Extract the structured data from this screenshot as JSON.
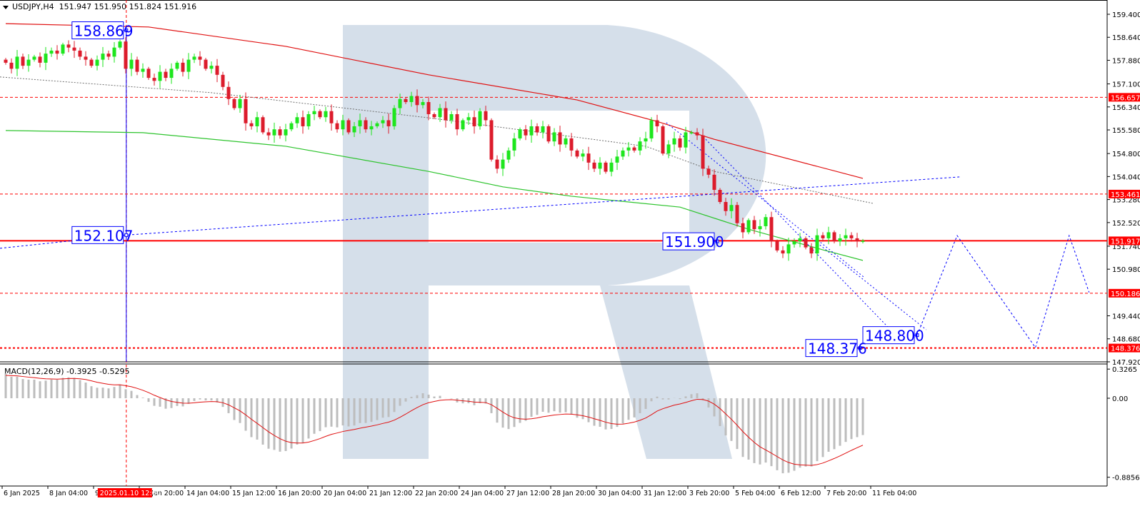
{
  "header": {
    "symbol": "USDJPY,H4",
    "ohlc": "151.947 151.950 151.824 151.916"
  },
  "macd": {
    "label": "MACD(12,26,9) -0.3925 -0.5295",
    "ticks": [
      "0.3265",
      "0.00",
      "-0.8856"
    ],
    "tick_values": [
      0.3265,
      0,
      -0.8856
    ]
  },
  "colors": {
    "up": "#1ee61e",
    "down": "#dc1c2c",
    "level": "#ff0000",
    "blue": "#0000ff",
    "ma_red": "#e01010",
    "ma_green": "#2ec42e",
    "gray": "#707070",
    "watermark": "#d5dfea",
    "hist": "#bdbdbd"
  },
  "chart_data": {
    "type": "candlestick",
    "ylim": [
      147.92,
      159.4
    ],
    "y_ticks": [
      "159.400",
      "158.640",
      "157.880",
      "157.100",
      "156.340",
      "155.580",
      "154.800",
      "154.040",
      "153.280",
      "152.520",
      "151.740",
      "150.980",
      "149.440",
      "148.680",
      "147.920"
    ],
    "x_ticks": [
      "6 Jan 2025",
      "8 Jan 04:00",
      "9 Jan 12:00",
      "10 Jan 20:00",
      "14 Jan 04:00",
      "15 Jan 12:00",
      "16 Jan 20:00",
      "20 Jan 04:00",
      "21 Jan 12:00",
      "22 Jan 20:00",
      "24 Jan 04:00",
      "27 Jan 12:00",
      "28 Jan 20:00",
      "30 Jan 04:00",
      "31 Jan 12:00",
      "3 Feb 20:00",
      "5 Feb 04:00",
      "6 Feb 12:00",
      "7 Feb 20:00",
      "11 Feb 04:00"
    ],
    "crosshair_time": "2025.01.10 12:00",
    "closes": [
      157.8,
      157.6,
      158.0,
      157.7,
      157.9,
      158.0,
      157.8,
      158.1,
      158.2,
      158.1,
      158.4,
      158.3,
      158.2,
      158.0,
      157.9,
      157.7,
      157.9,
      158.1,
      158.0,
      158.3,
      158.5,
      157.6,
      157.9,
      157.5,
      157.6,
      157.3,
      157.2,
      157.5,
      157.3,
      157.6,
      157.8,
      157.5,
      157.9,
      158.0,
      157.9,
      157.6,
      157.7,
      157.4,
      157.0,
      156.6,
      156.3,
      156.6,
      155.8,
      155.7,
      156.0,
      155.5,
      155.4,
      155.6,
      155.4,
      155.6,
      155.8,
      156.0,
      155.7,
      156.1,
      156.2,
      156.0,
      156.2,
      155.8,
      155.6,
      155.9,
      155.5,
      155.7,
      155.9,
      155.6,
      155.7,
      155.8,
      155.9,
      155.7,
      156.3,
      156.6,
      156.5,
      156.7,
      156.4,
      156.5,
      156.1,
      156.0,
      156.3,
      155.9,
      156.1,
      155.6,
      155.9,
      156.0,
      155.7,
      156.2,
      155.9,
      154.6,
      154.3,
      154.6,
      154.9,
      155.3,
      155.6,
      155.4,
      155.7,
      155.5,
      155.7,
      155.2,
      155.5,
      155.1,
      155.3,
      154.9,
      154.7,
      154.8,
      154.5,
      154.3,
      154.5,
      154.2,
      154.5,
      154.7,
      154.9,
      155.0,
      154.9,
      155.2,
      155.3,
      155.9,
      155.7,
      154.8,
      155.1,
      155.3,
      155.0,
      155.5,
      155.5,
      155.4,
      154.3,
      154.1,
      153.6,
      153.2,
      152.9,
      153.1,
      152.5,
      152.2,
      152.6,
      152.3,
      152.4,
      152.7,
      151.9,
      151.6,
      151.5,
      151.8,
      151.9,
      152.0,
      151.7,
      151.5,
      152.1,
      152.0,
      152.2,
      151.9,
      152.0,
      152.1,
      152.0,
      151.9,
      151.916
    ],
    "ma_red": [
      [
        0,
        159.09
      ],
      [
        25,
        158.98
      ],
      [
        49,
        158.34
      ],
      [
        74,
        157.4
      ],
      [
        100,
        156.57
      ],
      [
        114,
        155.86
      ],
      [
        124,
        155.27
      ],
      [
        150,
        153.98
      ]
    ],
    "ma_green": [
      [
        0,
        155.56
      ],
      [
        24,
        155.49
      ],
      [
        49,
        155.04
      ],
      [
        74,
        154.21
      ],
      [
        87,
        153.7
      ],
      [
        99,
        153.39
      ],
      [
        118,
        153.03
      ],
      [
        130,
        152.3
      ],
      [
        143,
        151.62
      ],
      [
        150,
        151.27
      ]
    ],
    "gray_trend": [
      [
        -1,
        157.33
      ],
      [
        36,
        156.81
      ],
      [
        74,
        155.98
      ],
      [
        112,
        155.04
      ],
      [
        124,
        154.21
      ],
      [
        151.9,
        153.15
      ]
    ],
    "blue_trend": [
      [
        -1,
        151.67
      ],
      [
        21.1,
        152.107
      ],
      [
        167.1,
        154.03
      ]
    ],
    "channel_lines": [
      [
        [
          115.6,
          155.82
        ],
        [
          161.1,
          148.98
        ]
      ],
      [
        [
          122.5,
          155.27
        ],
        [
          155,
          148.95
        ]
      ],
      [
        [
          142.1,
          151.94
        ],
        [
          150.3,
          150.7
        ]
      ]
    ],
    "forecast": [
      [
        159.5,
        148.8
      ],
      [
        166.5,
        152.09
      ],
      [
        180.2,
        148.39
      ],
      [
        186.1,
        152.09
      ],
      [
        189.6,
        150.21
      ]
    ],
    "levels": [
      {
        "value": 156.657,
        "label": "156.657",
        "style": "dashed"
      },
      {
        "value": 153.461,
        "label": "153.461",
        "style": "dashed"
      },
      {
        "value": 151.917,
        "label": "151.917",
        "style": "solid"
      },
      {
        "value": 150.186,
        "label": "150.186",
        "style": "dashed"
      },
      {
        "value": 148.376,
        "label": "148.376",
        "style": "dotted"
      }
    ],
    "price_labels": [
      {
        "text": "158.869",
        "bar": 21.1,
        "price": 158.869,
        "side": "left"
      },
      {
        "text": "152.107",
        "bar": 21.1,
        "price": 152.107,
        "side": "left"
      },
      {
        "text": "151.900",
        "bar": 124.5,
        "price": 151.9,
        "side": "left"
      },
      {
        "text": "148.800",
        "bar": 159.5,
        "price": 148.8,
        "side": "left"
      },
      {
        "text": "148.376",
        "bar": 149.5,
        "price": 148.376,
        "side": "left"
      }
    ],
    "crosshair_bar": 21.1
  }
}
